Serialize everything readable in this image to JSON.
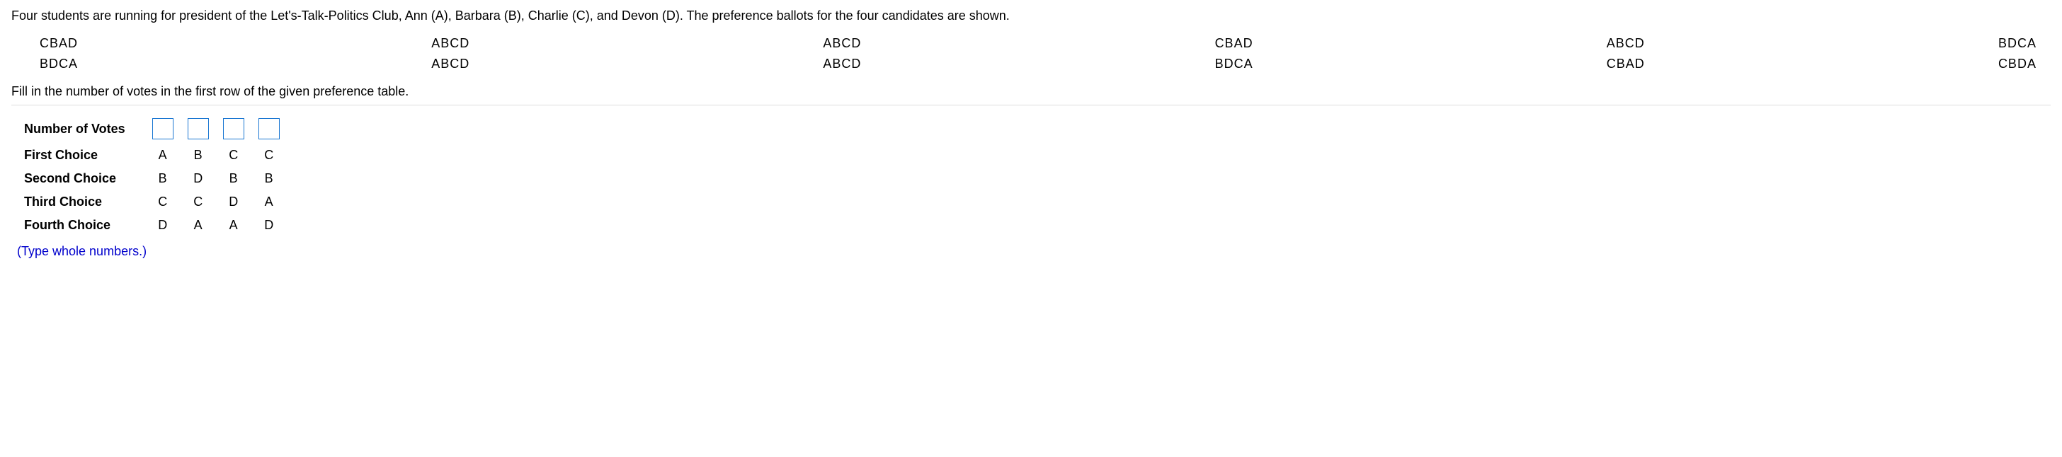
{
  "intro": "Four students are running for president of the Let's-Talk-Politics Club, Ann (A), Barbara (B), Charlie (C), and Devon (D). The preference ballots for the four candidates are shown.",
  "ballots": [
    [
      "CBAD",
      "BDCA"
    ],
    [
      "ABCD",
      "ABCD"
    ],
    [
      "ABCD",
      "ABCD"
    ],
    [
      "CBAD",
      "BDCA"
    ],
    [
      "ABCD",
      "CBAD"
    ],
    [
      "BDCA",
      "CBDA"
    ]
  ],
  "instruction": "Fill in the number of votes in the first row of the given preference table.",
  "table": {
    "rows": [
      {
        "label": "Number of Votes",
        "type": "input",
        "values": [
          "",
          "",
          "",
          ""
        ]
      },
      {
        "label": "First Choice",
        "type": "text",
        "values": [
          "A",
          "B",
          "C",
          "C"
        ]
      },
      {
        "label": "Second Choice",
        "type": "text",
        "values": [
          "B",
          "D",
          "B",
          "B"
        ]
      },
      {
        "label": "Third Choice",
        "type": "text",
        "values": [
          "C",
          "C",
          "D",
          "A"
        ]
      },
      {
        "label": "Fourth Choice",
        "type": "text",
        "values": [
          "D",
          "A",
          "A",
          "D"
        ]
      }
    ]
  },
  "hint": "(Type whole numbers.)"
}
